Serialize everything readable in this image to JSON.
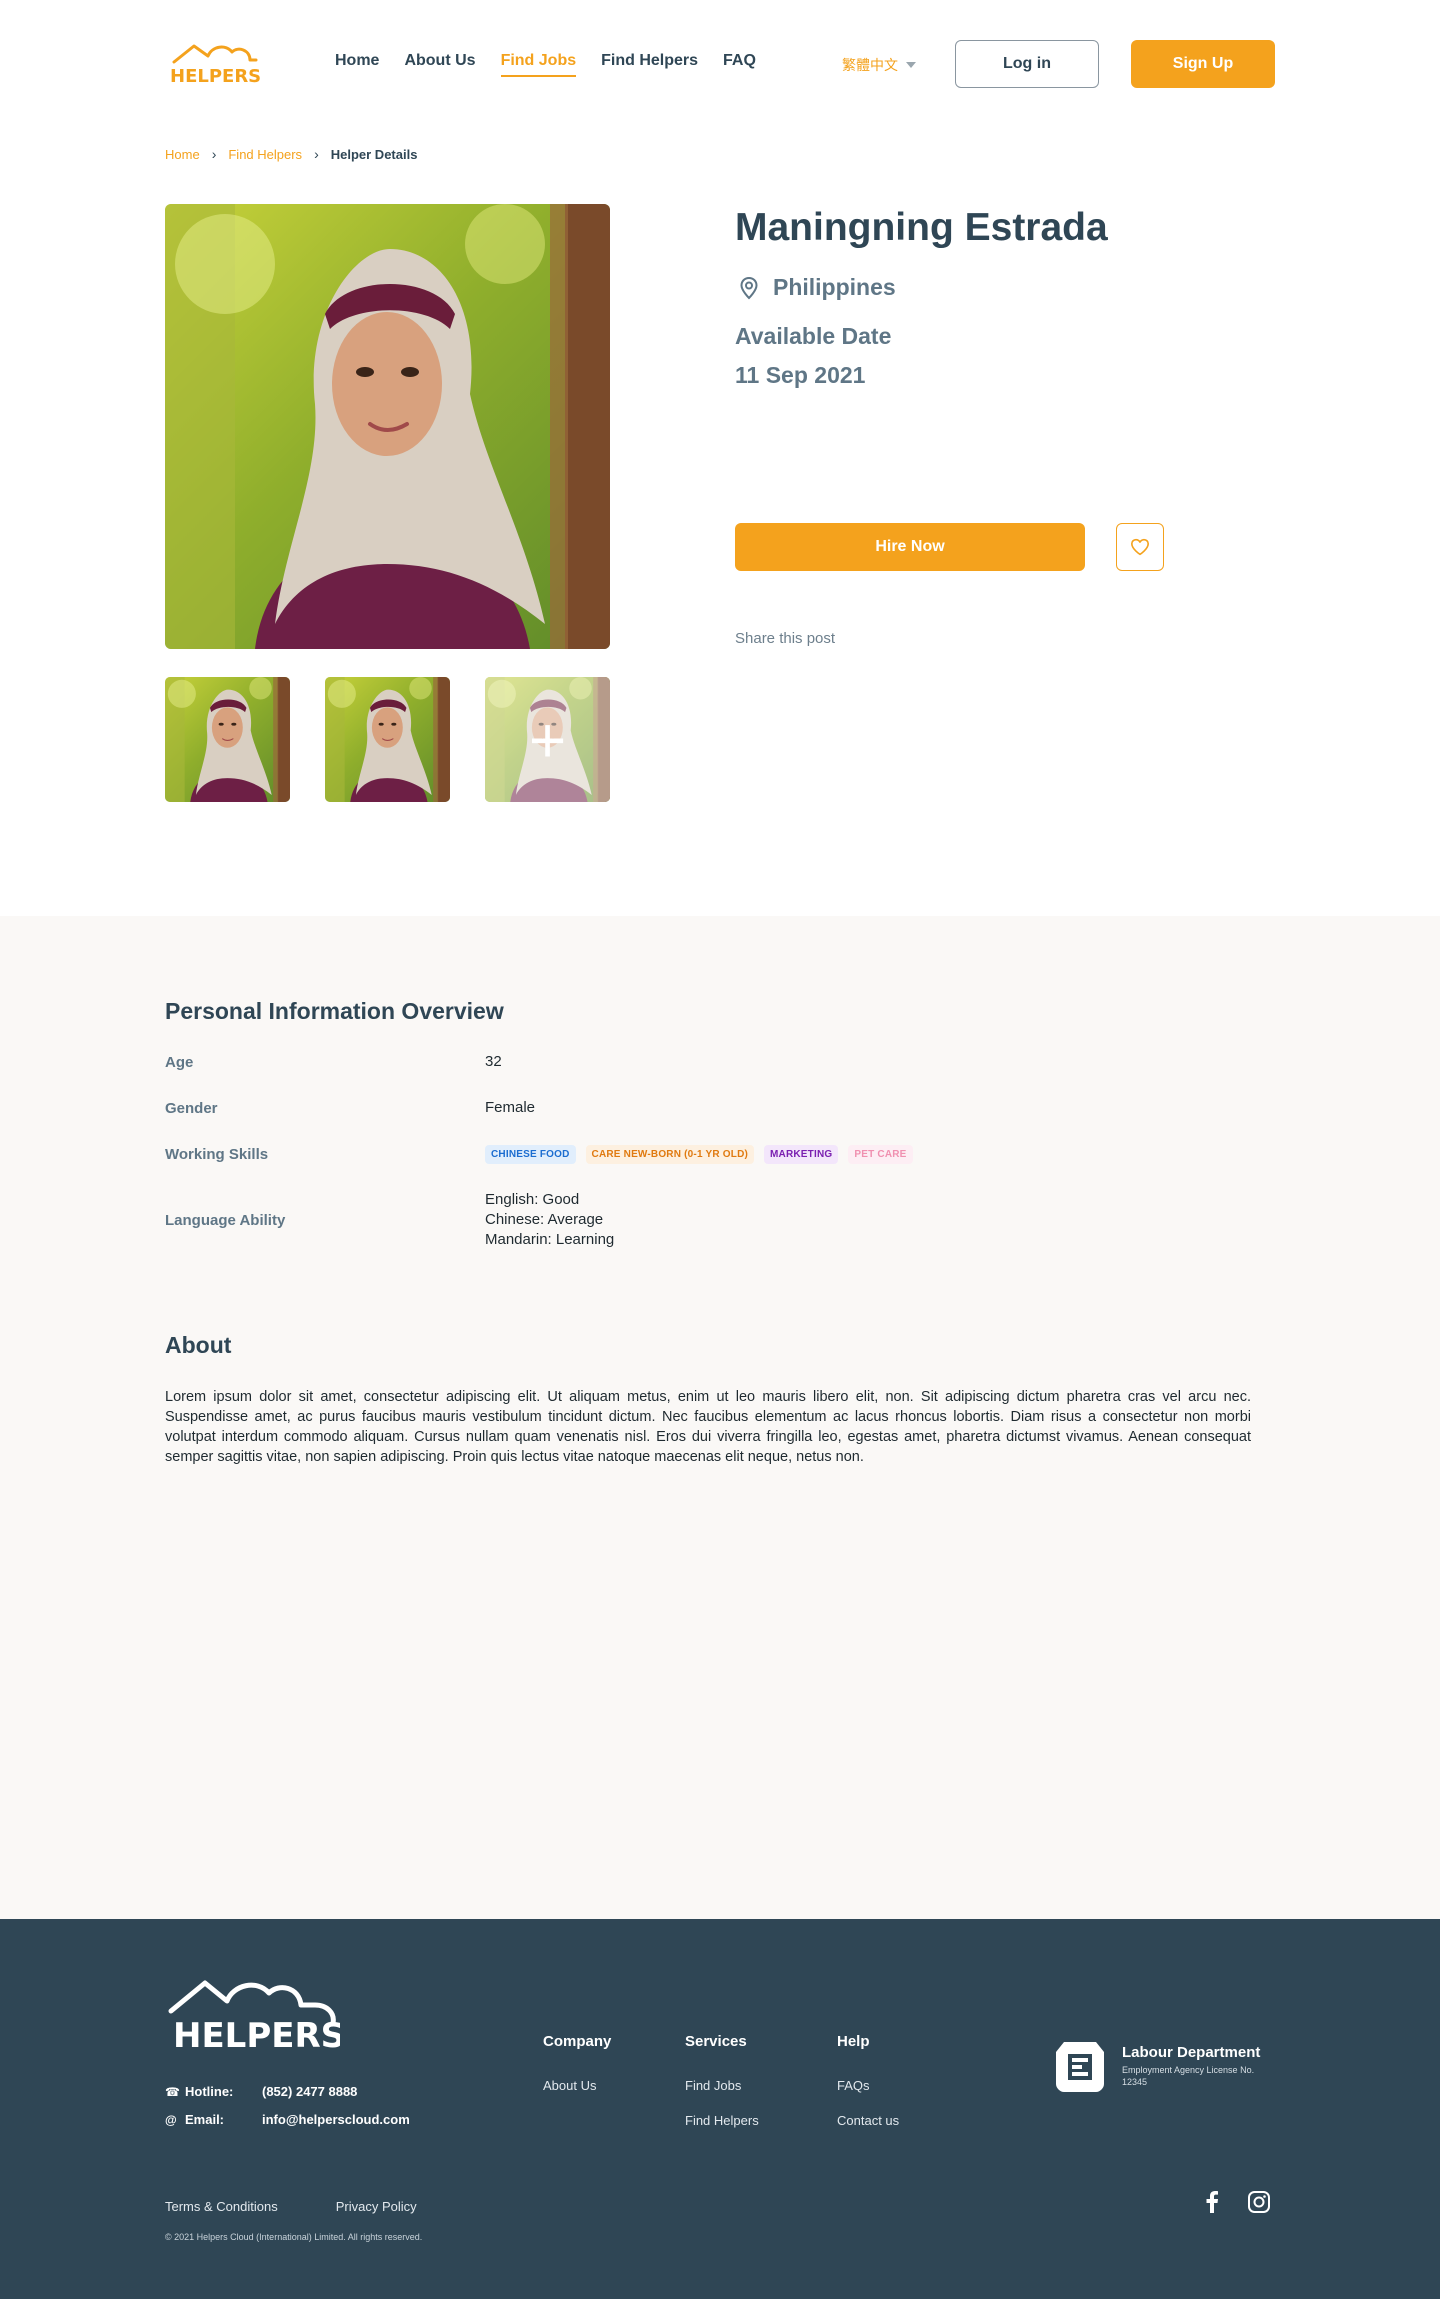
{
  "header": {
    "logo_text": "HELPERS",
    "nav": [
      {
        "label": "Home",
        "active": false
      },
      {
        "label": "About Us",
        "active": false
      },
      {
        "label": "Find Jobs",
        "active": true
      },
      {
        "label": "Find Helpers",
        "active": false
      },
      {
        "label": "FAQ",
        "active": false
      }
    ],
    "language": "繁體中文",
    "login_label": "Log in",
    "signup_label": "Sign Up"
  },
  "breadcrumb": {
    "items": [
      "Home",
      "Find Helpers"
    ],
    "current": "Helper Details"
  },
  "profile": {
    "name": "Maningning Estrada",
    "location": "Philippines",
    "available_label": "Available Date",
    "available_date": "11 Sep 2021",
    "hire_label": "Hire Now",
    "share_label": "Share this post",
    "thumbnail_add_icon": "plus-icon"
  },
  "overview": {
    "title": "Personal Information Overview",
    "age_label": "Age",
    "age": "32",
    "gender_label": "Gender",
    "gender": "Female",
    "skills_label": "Working Skills",
    "skills": [
      {
        "label": "CHINESE FOOD",
        "color": "#1c6dd0",
        "bg": "#e1eefc"
      },
      {
        "label": "CARE NEW-BORN (0-1 YR OLD)",
        "color": "#e07a10",
        "bg": "#fdf0e0"
      },
      {
        "label": "MARKETING",
        "color": "#7a1fb0",
        "bg": "#f3e6fb"
      },
      {
        "label": "PET CARE",
        "color": "#f090b0",
        "bg": "#fdeef4"
      }
    ],
    "language_label": "Language Ability",
    "languages": [
      "English: Good",
      "Chinese: Average",
      "Mandarin: Learning"
    ]
  },
  "about": {
    "title": "About",
    "text": "Lorem ipsum dolor sit amet, consectetur adipiscing elit. Ut aliquam metus, enim ut leo mauris libero elit, non. Sit adipiscing dictum pharetra cras vel arcu nec. Suspendisse amet, ac purus faucibus mauris vestibulum tincidunt dictum. Nec faucibus elementum ac lacus rhoncus lobortis. Diam risus a consectetur non morbi volutpat interdum commodo aliquam. Cursus nullam quam venenatis nisl. Eros dui viverra fringilla leo, egestas amet, pharetra dictumst vivamus. Aenean consequat semper sagittis vitae, non sapien adipiscing. Proin quis lectus vitae natoque maecenas elit neque, netus non."
  },
  "footer": {
    "logo_text": "HELPERS",
    "hotline_label": "Hotline:",
    "hotline": "(852) 2477 8888",
    "email_label": "Email:",
    "email": "info@helperscloud.com",
    "columns": [
      {
        "title": "Company",
        "links": [
          "About Us"
        ]
      },
      {
        "title": "Services",
        "links": [
          "Find Jobs",
          "Find Helpers"
        ]
      },
      {
        "title": "Help",
        "links": [
          "FAQs",
          "Contact us"
        ]
      }
    ],
    "labour_title": "Labour Department",
    "labour_sub": "Employment Agency License No. 12345",
    "terms": "Terms & Conditions",
    "privacy": "Privacy Policy",
    "copyright": "© 2021 Helpers Cloud (International) Limited. All rights reserved.",
    "social_icons": [
      "facebook-icon",
      "instagram-icon"
    ]
  },
  "colors": {
    "accent": "#f4a21d",
    "text_dark": "#2f4655",
    "text_muted": "#5f7686",
    "footer_bg": "#2f4655",
    "section_bg": "#faf8f6"
  }
}
